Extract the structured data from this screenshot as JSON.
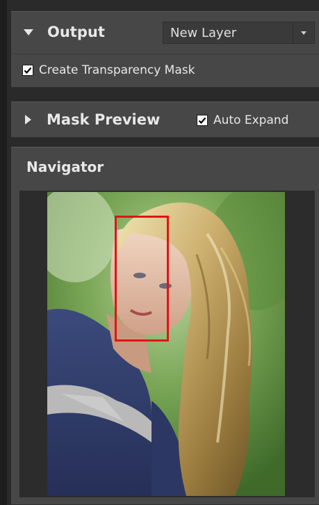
{
  "output": {
    "title": "Output",
    "select_value": "New Layer",
    "create_mask_label": "Create Transparency Mask",
    "create_mask_checked": true
  },
  "mask_preview": {
    "title": "Mask Preview",
    "auto_expand_label": "Auto Expand",
    "auto_expand_checked": true
  },
  "navigator": {
    "title": "Navigator"
  },
  "icons": {
    "output_toggle": "triangle-down-icon",
    "mask_toggle": "triangle-right-icon",
    "select_caret": "chevron-down-icon"
  },
  "colors": {
    "panel_bg": "#474747",
    "view_rect": "#e01414"
  }
}
